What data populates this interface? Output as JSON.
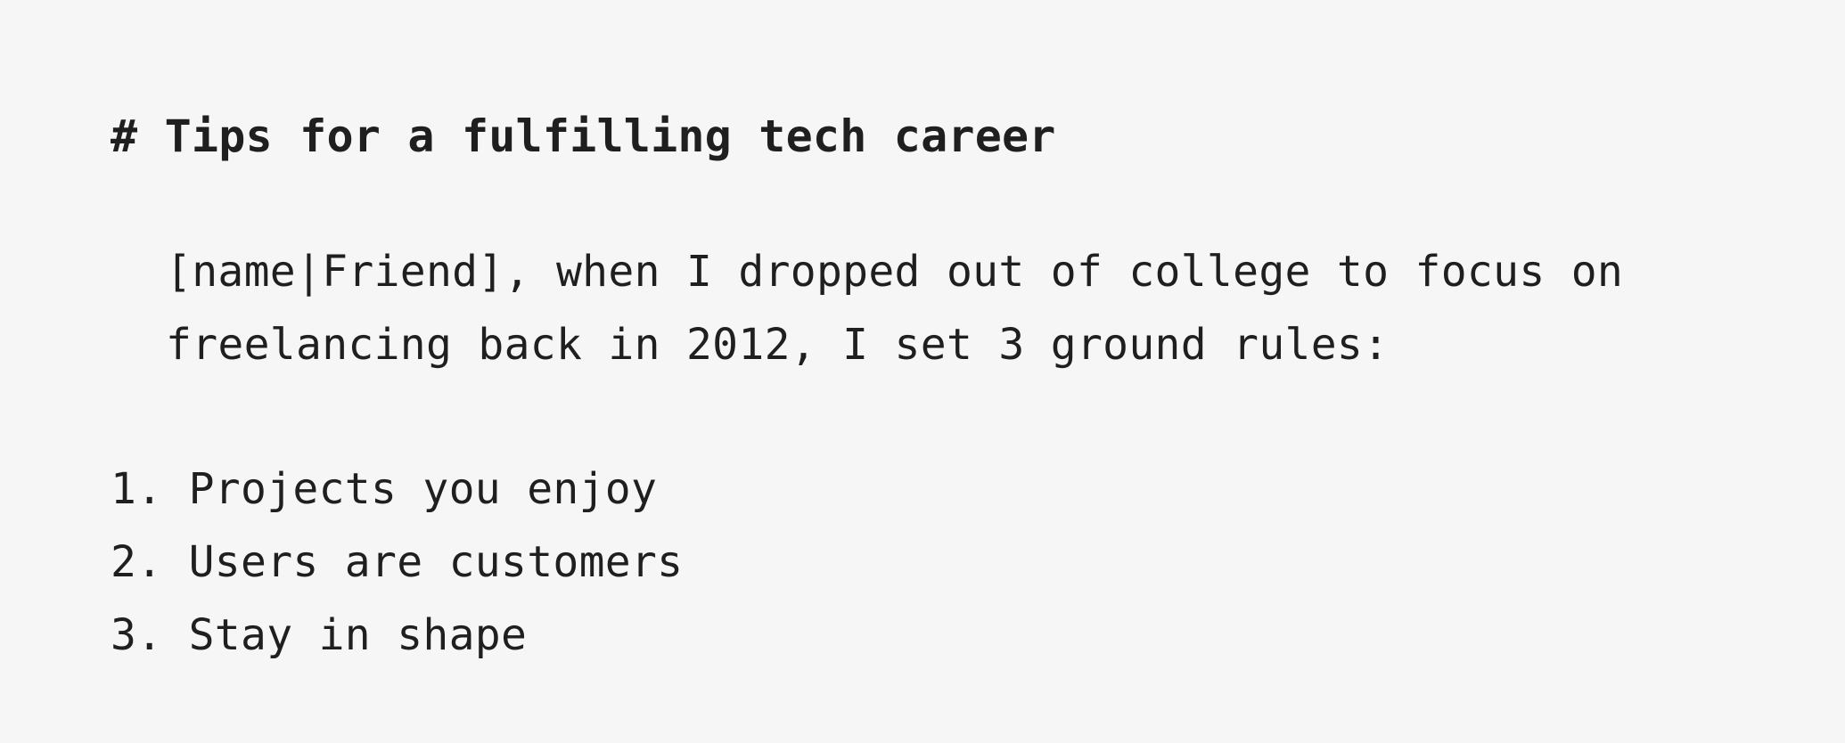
{
  "doc": {
    "heading_marker": "#",
    "heading_text": "Tips for a fulfilling tech career",
    "paragraph_lines": [
      "[name|Friend], when I dropped out of college to focus on",
      "freelancing back in 2012, I set 3 ground rules:"
    ],
    "list": [
      {
        "num": "1.",
        "text": "Projects you enjoy"
      },
      {
        "num": "2.",
        "text": "Users are customers"
      },
      {
        "num": "3.",
        "text": "Stay in shape"
      }
    ]
  }
}
